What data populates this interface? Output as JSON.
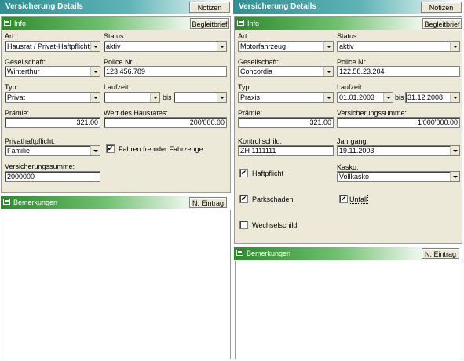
{
  "left": {
    "title": "Versicherung Details",
    "notizen": "Notizen",
    "info": {
      "header": "Info",
      "begleitbrief": "Begleitbrief",
      "art_label": "Art:",
      "art_value": "Hausrat / Privat-Haftpflicht",
      "status_label": "Status:",
      "status_value": "aktiv",
      "gesellschaft_label": "Gesellschaft:",
      "gesellschaft_value": "Winterthur",
      "police_label": "Police Nr.",
      "police_value": "123.456.789",
      "typ_label": "Typ:",
      "typ_value": "Privat",
      "laufzeit_label": "Laufzeit:",
      "laufzeit_from": "",
      "laufzeit_bis": "bis",
      "laufzeit_to": "",
      "praemie_label": "Prämie:",
      "praemie_value": "321.00",
      "wert_label": "Wert des Hausrates:",
      "wert_value": "200'000.00",
      "privathaft_label": "Privathaftpflicht:",
      "privathaft_value": "Familie",
      "fahren_label": "Fahren fremder Fahrzeuge",
      "fahren_checked": "✔",
      "vsumme_label": "Versicherungssumme:",
      "vsumme_value": "2000000"
    },
    "bemerkungen": {
      "header": "Bemerkungen",
      "button": "N. Eintrag"
    }
  },
  "right": {
    "title": "Versicherung Details",
    "notizen": "Notizen",
    "info": {
      "header": "Info",
      "begleitbrief": "Begleitbrief",
      "art_label": "Art:",
      "art_value": "Motorfahrzeug",
      "status_label": "Status:",
      "status_value": "aktiv",
      "gesellschaft_label": "Gesellschaft:",
      "gesellschaft_value": "Concordia",
      "police_label": "Police Nr.",
      "police_value": "122.58.23.204",
      "typ_label": "Typ:",
      "typ_value": "Praxis",
      "laufzeit_label": "Laufzeit:",
      "laufzeit_from": "01.01.2003",
      "laufzeit_bis": "bis",
      "laufzeit_to": "31.12.2008",
      "praemie_label": "Prämie:",
      "praemie_value": "321.00",
      "vsumme_label": "Versicherungssumme:",
      "vsumme_value": "1'000'000.00",
      "kontroll_label": "Kontrollschild:",
      "kontroll_value": "ZH 1111111",
      "jahrgang_label": "Jahrgang:",
      "jahrgang_value": "19.11.2003",
      "kasko_label": "Kasko:",
      "kasko_value": "Vollkasko",
      "haftpflicht_label": "Haftpflicht",
      "haftpflicht_checked": "✔",
      "parkschaden_label": "Parkschaden",
      "parkschaden_checked": "✔",
      "unfall_label": "Unfall",
      "unfall_checked": "✔",
      "wechselschild_label": "Wechselschild",
      "wechselschild_checked": ""
    },
    "bemerkungen": {
      "header": "Bemerkungen",
      "button": "N. Eintrag"
    }
  },
  "colors": {
    "title_gradient_start": "#2f8f92",
    "section_gradient_start": "#2c8a2c",
    "panel_bg": "#ece9d8"
  }
}
